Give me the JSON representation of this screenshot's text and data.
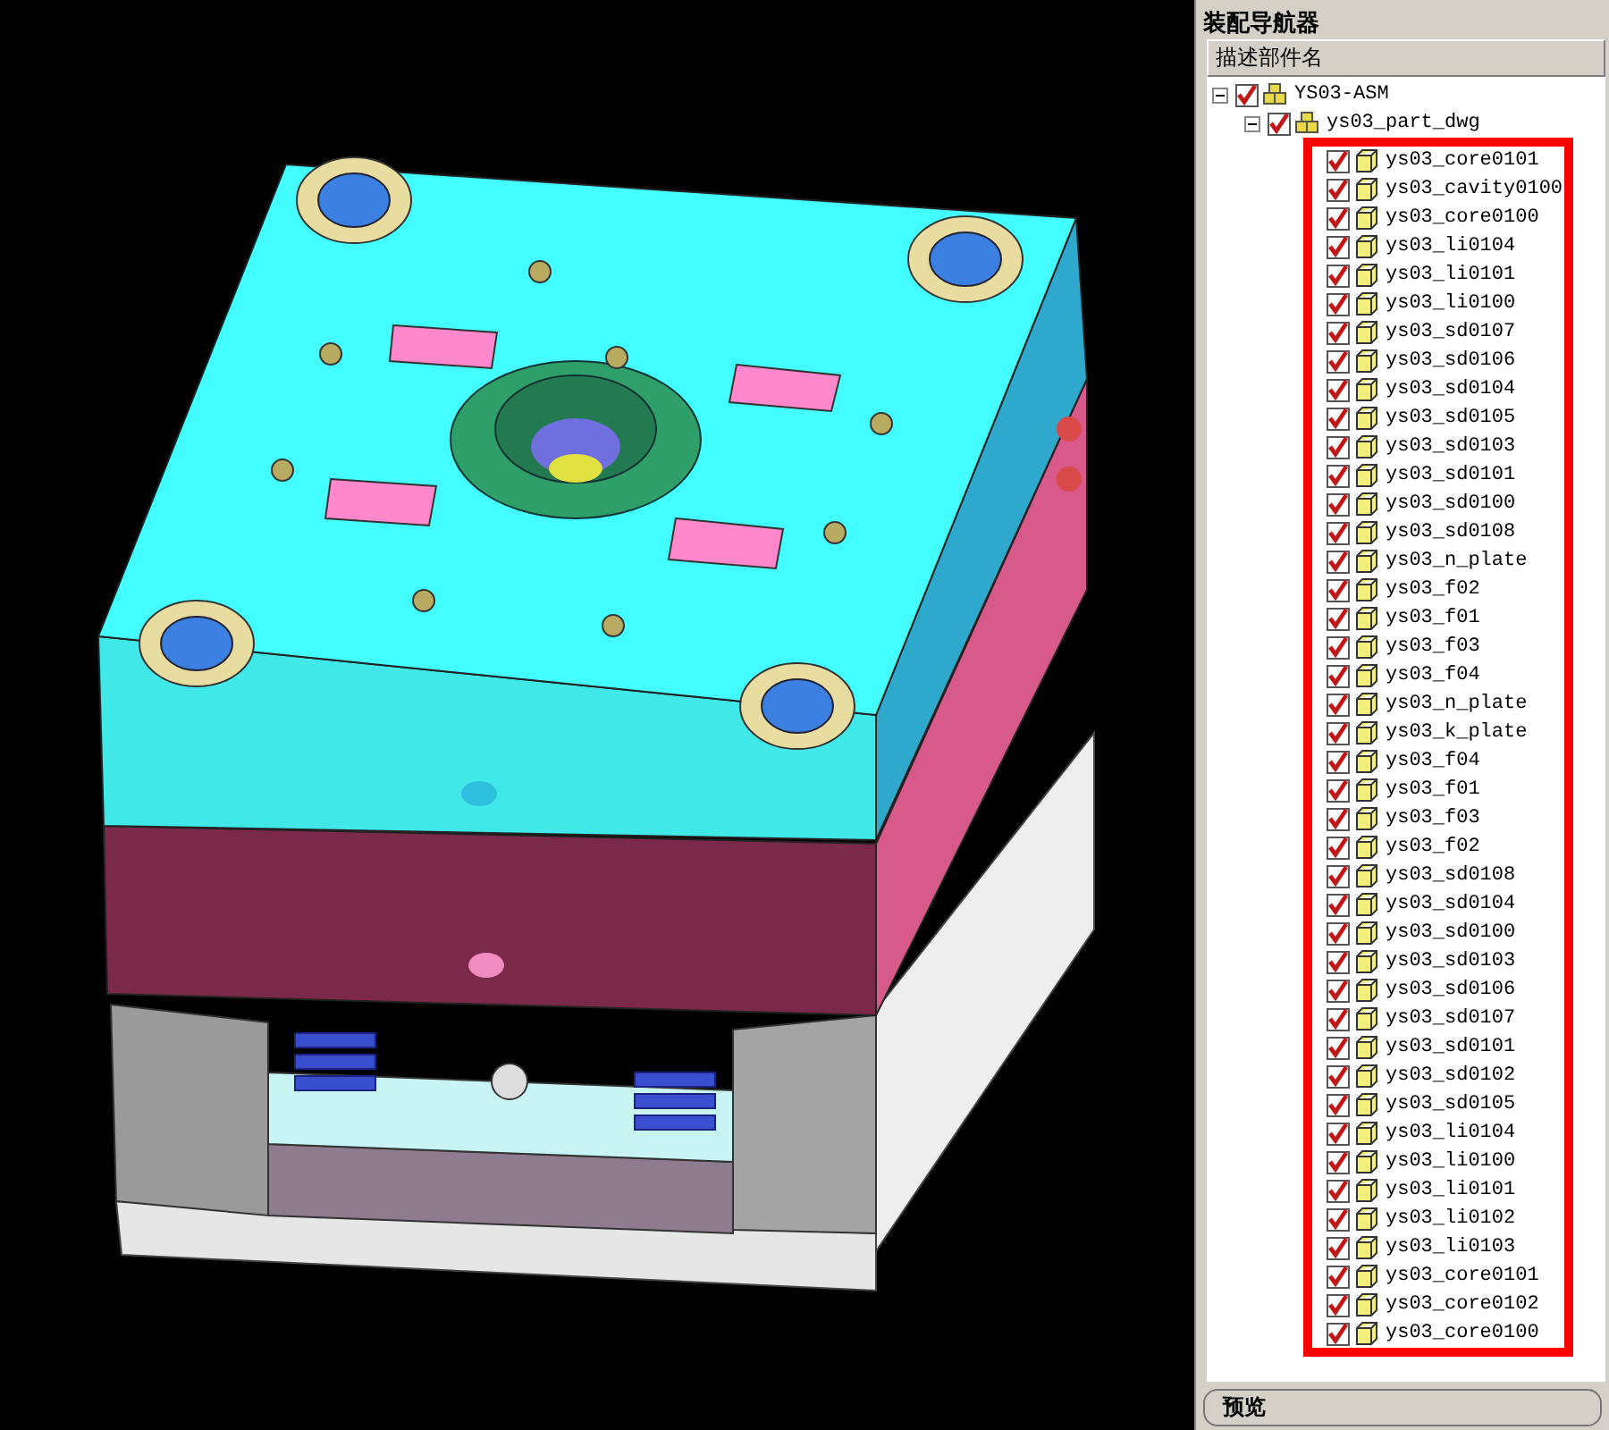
{
  "navigator": {
    "title": "装配导航器",
    "column_header": "描述部件名",
    "tree": [
      {
        "label": "YS03-ASM",
        "kind": "assembly",
        "checked": true,
        "expanded": true,
        "children": [
          {
            "label": "ys03_part_dwg",
            "kind": "assembly",
            "checked": true,
            "expanded": true,
            "highlight_frame": true,
            "children": [
              {
                "label": "ys03_core0101",
                "kind": "part",
                "checked": true
              },
              {
                "label": "ys03_cavity0100",
                "kind": "part",
                "checked": true
              },
              {
                "label": "ys03_core0100",
                "kind": "part",
                "checked": true
              },
              {
                "label": "ys03_li0104",
                "kind": "part",
                "checked": true
              },
              {
                "label": "ys03_li0101",
                "kind": "part",
                "checked": true
              },
              {
                "label": "ys03_li0100",
                "kind": "part",
                "checked": true
              },
              {
                "label": "ys03_sd0107",
                "kind": "part",
                "checked": true
              },
              {
                "label": "ys03_sd0106",
                "kind": "part",
                "checked": true
              },
              {
                "label": "ys03_sd0104",
                "kind": "part",
                "checked": true
              },
              {
                "label": "ys03_sd0105",
                "kind": "part",
                "checked": true
              },
              {
                "label": "ys03_sd0103",
                "kind": "part",
                "checked": true
              },
              {
                "label": "ys03_sd0101",
                "kind": "part",
                "checked": true
              },
              {
                "label": "ys03_sd0100",
                "kind": "part",
                "checked": true
              },
              {
                "label": "ys03_sd0108",
                "kind": "part",
                "checked": true
              },
              {
                "label": "ys03_n_plate",
                "kind": "part",
                "checked": true
              },
              {
                "label": "ys03_f02",
                "kind": "part",
                "checked": true
              },
              {
                "label": "ys03_f01",
                "kind": "part",
                "checked": true
              },
              {
                "label": "ys03_f03",
                "kind": "part",
                "checked": true
              },
              {
                "label": "ys03_f04",
                "kind": "part",
                "checked": true
              },
              {
                "label": "ys03_n_plate",
                "kind": "part",
                "checked": true
              },
              {
                "label": "ys03_k_plate",
                "kind": "part",
                "checked": true
              },
              {
                "label": "ys03_f04",
                "kind": "part",
                "checked": true
              },
              {
                "label": "ys03_f01",
                "kind": "part",
                "checked": true
              },
              {
                "label": "ys03_f03",
                "kind": "part",
                "checked": true
              },
              {
                "label": "ys03_f02",
                "kind": "part",
                "checked": true
              },
              {
                "label": "ys03_sd0108",
                "kind": "part",
                "checked": true
              },
              {
                "label": "ys03_sd0104",
                "kind": "part",
                "checked": true
              },
              {
                "label": "ys03_sd0100",
                "kind": "part",
                "checked": true
              },
              {
                "label": "ys03_sd0103",
                "kind": "part",
                "checked": true
              },
              {
                "label": "ys03_sd0106",
                "kind": "part",
                "checked": true
              },
              {
                "label": "ys03_sd0107",
                "kind": "part",
                "checked": true
              },
              {
                "label": "ys03_sd0101",
                "kind": "part",
                "checked": true
              },
              {
                "label": "ys03_sd0102",
                "kind": "part",
                "checked": true
              },
              {
                "label": "ys03_sd0105",
                "kind": "part",
                "checked": true
              },
              {
                "label": "ys03_li0104",
                "kind": "part",
                "checked": true
              },
              {
                "label": "ys03_li0100",
                "kind": "part",
                "checked": true
              },
              {
                "label": "ys03_li0101",
                "kind": "part",
                "checked": true
              },
              {
                "label": "ys03_li0102",
                "kind": "part",
                "checked": true
              },
              {
                "label": "ys03_li0103",
                "kind": "part",
                "checked": true
              },
              {
                "label": "ys03_core0101",
                "kind": "part",
                "checked": true
              },
              {
                "label": "ys03_core0102",
                "kind": "part",
                "checked": true
              },
              {
                "label": "ys03_core0100",
                "kind": "part",
                "checked": true
              }
            ]
          }
        ]
      }
    ]
  },
  "preview": {
    "label": "预览"
  }
}
